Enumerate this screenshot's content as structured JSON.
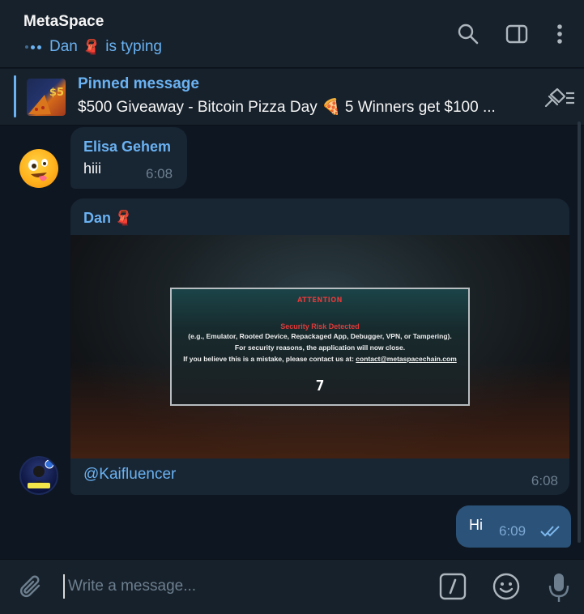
{
  "header": {
    "title": "MetaSpace",
    "typing_user": "Dan",
    "typing_suffix": "is typing"
  },
  "pinned": {
    "label": "Pinned message",
    "text": "$500 Giveaway - Bitcoin Pizza Day 🍕  5 Winners get $100 ...",
    "thumb_text": "$5"
  },
  "messages": [
    {
      "sender": "Elisa Gehem",
      "text": "hiii",
      "time": "6:08"
    },
    {
      "sender": "Dan",
      "media": {
        "attention": "ATTENTION",
        "risk": "Security Risk Detected",
        "line1": "(e.g., Emulator, Rooted Device, Repackaged App, Debugger, VPN, or Tampering).",
        "line2": "For security reasons, the application will now close.",
        "line3_prefix": "If you believe this is a mistake, please contact us at:",
        "contact": "contact@metaspacechain.com",
        "countdown": "7"
      },
      "text": "@Kaifluencer",
      "time": "6:08"
    },
    {
      "sender": "me",
      "text": "Hi",
      "time": "6:09"
    }
  ],
  "composer": {
    "placeholder": "Write a message..."
  },
  "colors": {
    "accent": "#6ab2f2",
    "background": "#0e1621",
    "panel": "#17212b",
    "bubble_in": "#182533",
    "bubble_out": "#2b5278"
  }
}
